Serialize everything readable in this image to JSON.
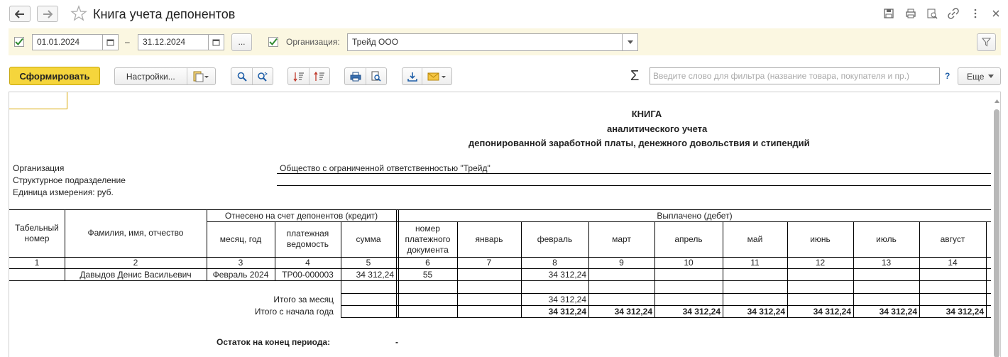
{
  "window": {
    "title": "Книга учета депонентов"
  },
  "filters": {
    "date_from": "01.01.2024",
    "date_sep": "–",
    "date_to": "31.12.2024",
    "period_btn": "...",
    "org_label": "Организация:",
    "org_value": "Трейд ООО"
  },
  "toolbar": {
    "generate_label": "Сформировать",
    "settings_label": "Настройки...",
    "sigma": "Σ",
    "search_placeholder": "Введите слово для фильтра (название товара, покупателя и пр.)",
    "help": "?",
    "more_label": "Еще"
  },
  "report": {
    "title1": "КНИГА",
    "title2": "аналитического учета",
    "title3": "депонированной заработной платы, денежного довольствия и стипендий",
    "org_label": "Организация",
    "org_value": "Общество с ограниченной ответственностью \"Трейд\"",
    "dept_label": "Структурное подразделение",
    "unit_label": "Единица измерения: руб.",
    "table": {
      "h_tab": "Табельный номер",
      "h_fio": "Фамилия, имя, отчество",
      "h_credit": "Отнесено на счет депонентов (кредит)",
      "h_month": "месяц, год",
      "h_stmt": "платежная ведомость",
      "h_sum": "сумма",
      "h_debit": "Выплачено (дебет)",
      "h_docnum": "номер платежного документа",
      "months": [
        "январь",
        "февраль",
        "март",
        "апрель",
        "май",
        "июнь",
        "июль",
        "август"
      ],
      "col_numbers": [
        "1",
        "2",
        "3",
        "4",
        "5",
        "6",
        "7",
        "8",
        "9",
        "10",
        "11",
        "12",
        "13",
        "14"
      ],
      "row": {
        "fio": "Давыдов Денис Васильевич",
        "month": "Февраль 2024",
        "stmt": "ТР00-000003",
        "sum": "34 312,24",
        "docnum": "55",
        "feb": "34 312,24"
      },
      "total_month_label": "Итого за месяц",
      "total_month_feb": "34 312,24",
      "total_year_label": "Итого с начала года",
      "total_year_values": [
        "34 312,24",
        "34 312,24",
        "34 312,24",
        "34 312,24",
        "34 312,24",
        "34 312,24",
        "34 312,24"
      ]
    },
    "balance_label": "Остаток на конец периода:",
    "balance_value": "-"
  }
}
